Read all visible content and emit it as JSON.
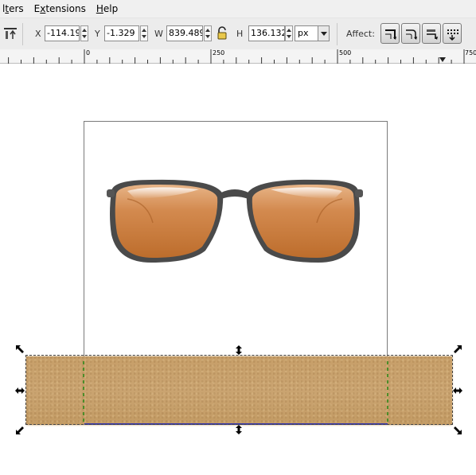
{
  "menubar": {
    "items": [
      {
        "label": "lters",
        "underline_index": 1
      },
      {
        "label": "Extensions",
        "underline_index": 1
      },
      {
        "label": "Help",
        "underline_index": 0
      }
    ]
  },
  "toolbar": {
    "x_label": "X",
    "x_value": "-114.19.",
    "y_label": "Y",
    "y_value": "-1.329",
    "w_label": "W",
    "w_value": "839.489",
    "h_label": "H",
    "h_value": "136.132",
    "unit": "px",
    "affect_label": "Affect:"
  },
  "ruler": {
    "labels": [
      "0",
      "250",
      "500",
      "750"
    ]
  },
  "colors": {
    "menubar_bg": "#f0f0f0",
    "toolbar_bg": "#ececec",
    "cork": "#c9a36d",
    "lens": "#c8773a",
    "frame": "#4a4a4a",
    "page_bottom_line": "#3a3aa8"
  },
  "icons": {
    "toolbar_select_icon": "align-top-icon",
    "lock_icon": "lock-open-icon",
    "affect_icons": [
      "scale-stroke-icon",
      "scale-corners-icon",
      "move-gradients-icon",
      "move-patterns-icon"
    ]
  }
}
